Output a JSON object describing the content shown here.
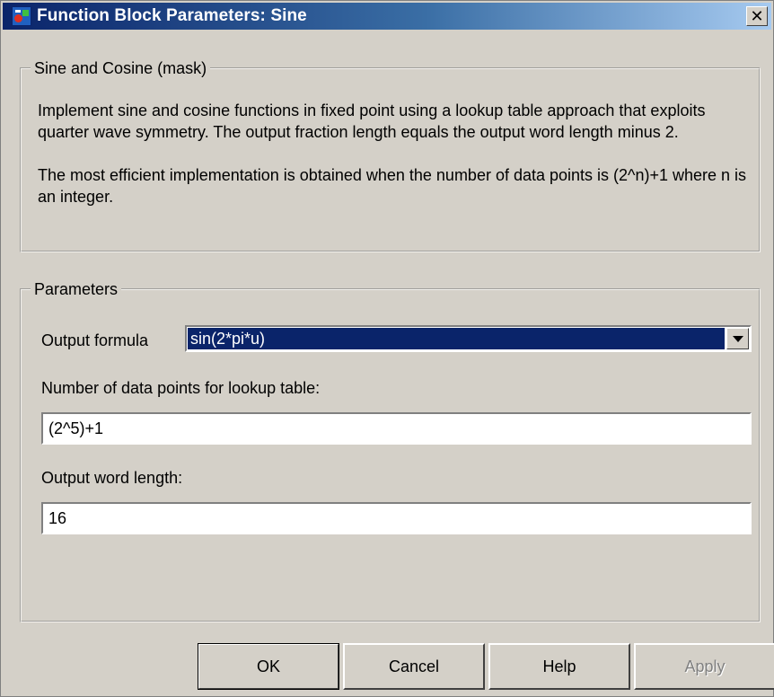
{
  "window": {
    "title": "Function Block Parameters: Sine",
    "close_glyph": "✕"
  },
  "mask_group": {
    "legend": "Sine and Cosine (mask)",
    "description_1": "Implement sine and cosine functions in fixed point using a lookup table approach that exploits quarter wave symmetry. The output fraction length equals the output word length minus 2.",
    "description_2": "The most efficient implementation is obtained when the number of data points is (2^n)+1 where n is an integer."
  },
  "parameters_group": {
    "legend": "Parameters",
    "output_formula": {
      "label": "Output formula",
      "selected": "sin(2*pi*u)"
    },
    "data_points": {
      "label": "Number of data points for lookup table:",
      "value": "(2^5)+1"
    },
    "word_length": {
      "label": "Output word length:",
      "value": "16"
    }
  },
  "buttons": {
    "ok": "OK",
    "cancel": "Cancel",
    "help": "Help",
    "apply": "Apply"
  },
  "colors": {
    "dialog_face": "#d4d0c8",
    "title_bar_start": "#0a246a",
    "title_bar_end": "#a6caf0",
    "selection": "#0a246a"
  },
  "icons": {
    "app": "simulink-block-icon",
    "close": "close-icon",
    "dropdown": "chevron-down-icon"
  }
}
